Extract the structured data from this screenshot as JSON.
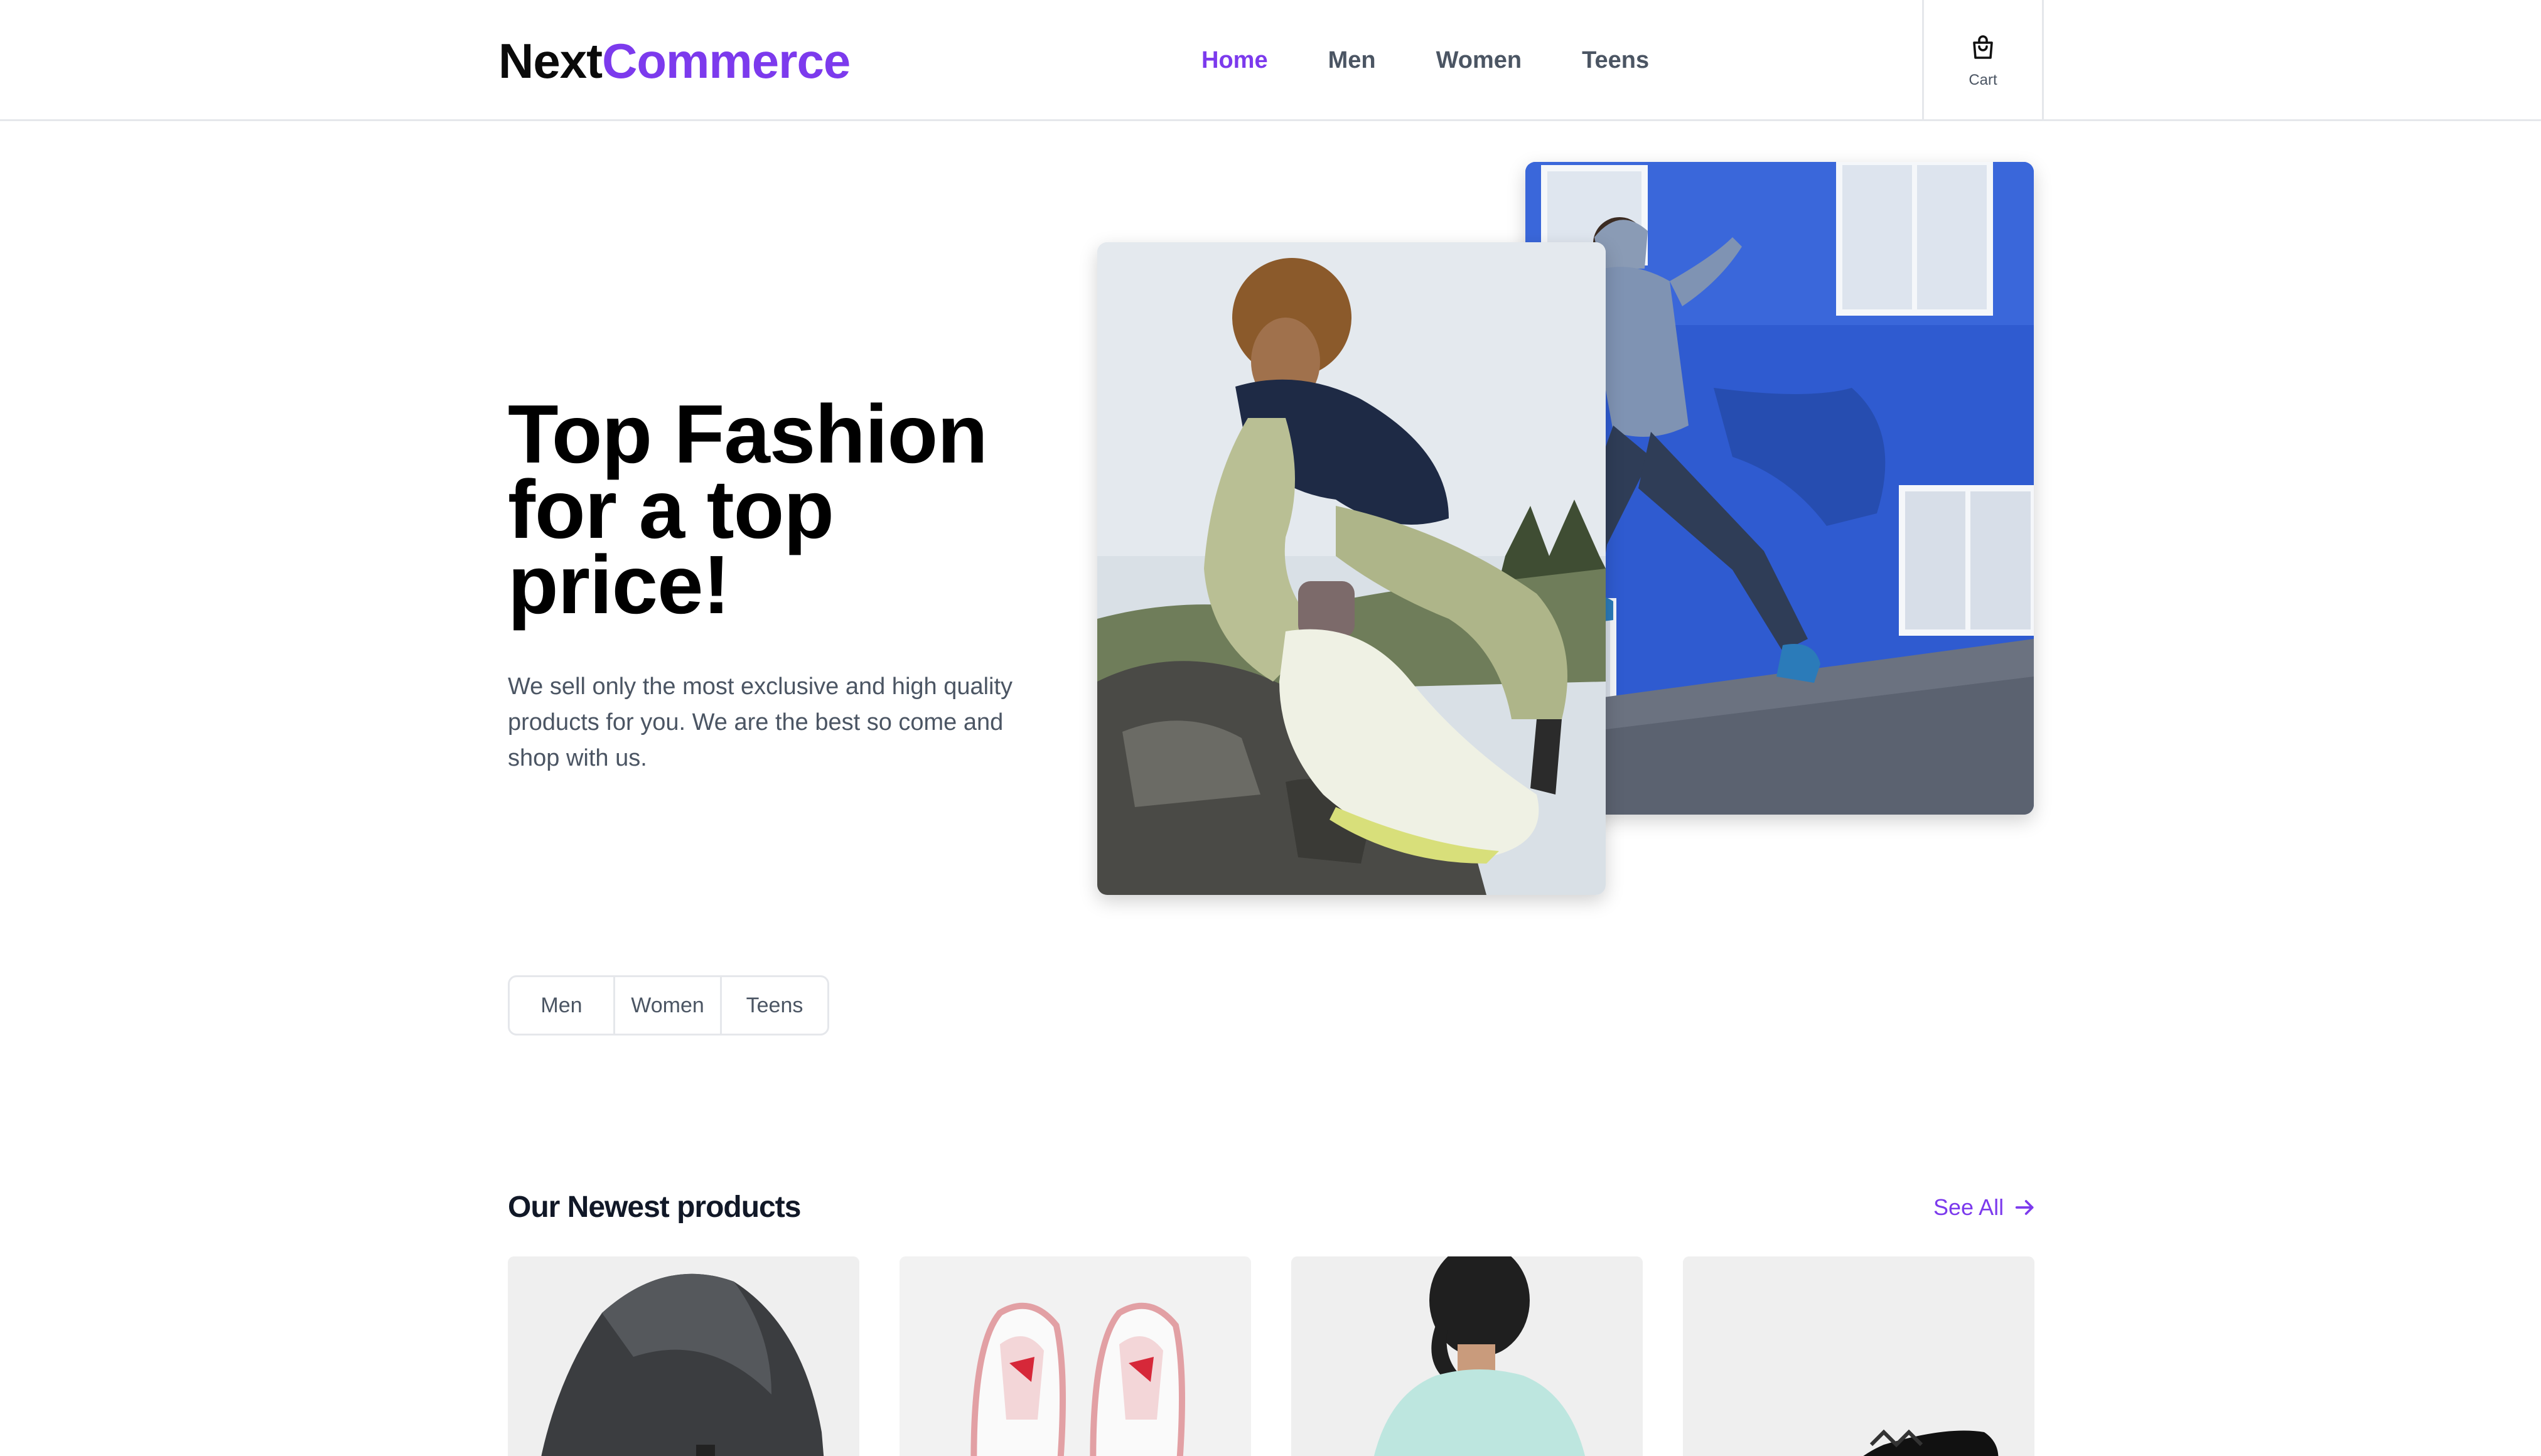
{
  "brand": {
    "part1": "Next",
    "part2": "Commerce"
  },
  "nav": {
    "items": [
      "Home",
      "Men",
      "Women",
      "Teens"
    ],
    "active": "Home"
  },
  "cart": {
    "label": "Cart",
    "icon": "shopping-bag-icon"
  },
  "hero": {
    "title": "Top Fashion for a top price!",
    "text": "We sell only the most exclusive and high quality products for you. We are the best so come and shop with us."
  },
  "categories": [
    "Men",
    "Women",
    "Teens"
  ],
  "products": {
    "title": "Our Newest products",
    "see_all": "See All"
  },
  "colors": {
    "accent": "#7c3aed",
    "text": "#111827",
    "muted": "#4b5563",
    "border": "#e5e7eb"
  }
}
